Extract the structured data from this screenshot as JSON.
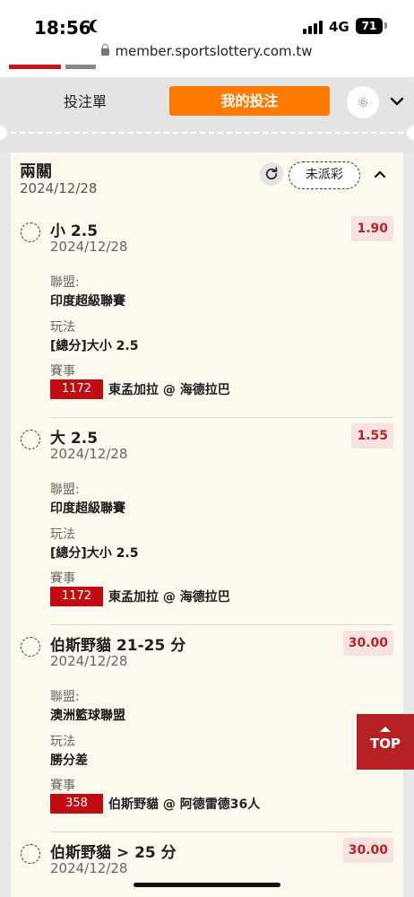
{
  "status_bar": {
    "time": "18:56",
    "network": "4G",
    "battery": "71"
  },
  "browser": {
    "url": "member.sportslottery.com.tw"
  },
  "tabs": {
    "bet_slip": "投注單",
    "my_bets": "我的投注"
  },
  "ticket": {
    "title": "兩關",
    "date": "2024/12/28",
    "status": "未派彩",
    "bets": [
      {
        "selection": "小 2.5",
        "date": "2024/12/28",
        "odds": "1.90",
        "league_label": "聯盟:",
        "league": "印度超級聯賽",
        "market_label": "玩法",
        "market": "[總分]大小 2.5",
        "event_label": "賽事",
        "event_no": "1172",
        "event": "東孟加拉 @ 海德拉巴"
      },
      {
        "selection": "大 2.5",
        "date": "2024/12/28",
        "odds": "1.55",
        "league_label": "聯盟:",
        "league": "印度超級聯賽",
        "market_label": "玩法",
        "market": "[總分]大小 2.5",
        "event_label": "賽事",
        "event_no": "1172",
        "event": "東孟加拉 @ 海德拉巴"
      },
      {
        "selection": "伯斯野貓 21-25 分",
        "date": "2024/12/28",
        "odds": "30.00",
        "league_label": "聯盟:",
        "league": "澳洲籃球聯盟",
        "market_label": "玩法",
        "market": "勝分差",
        "event_label": "賽事",
        "event_no": "358",
        "event": "伯斯野貓 @ 阿德雷德36人"
      },
      {
        "selection": "伯斯野貓 > 25 分",
        "date": "2024/12/28",
        "odds": "30.00"
      }
    ]
  },
  "top_button": "TOP",
  "colors": {
    "brand_orange": "#ff7a00",
    "brand_red": "#c10c13",
    "odds_text": "#b8232a"
  }
}
